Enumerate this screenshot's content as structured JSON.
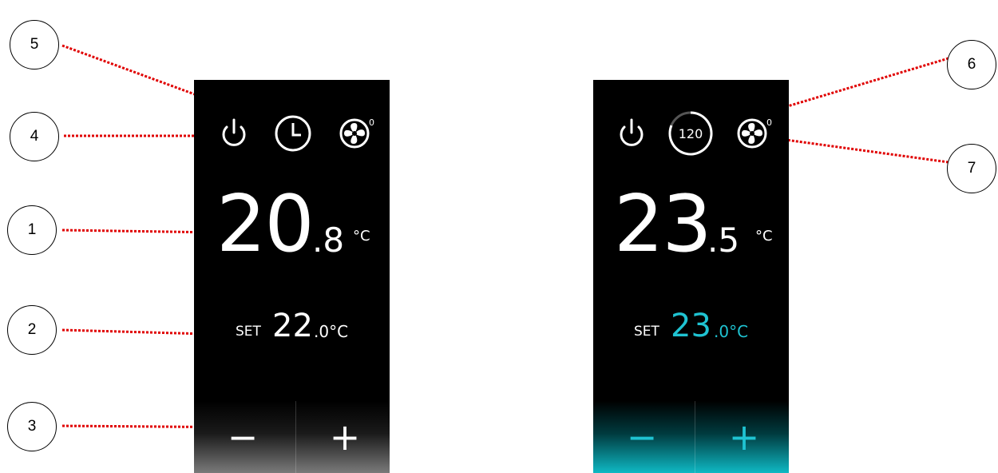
{
  "callouts": [
    {
      "num": "1"
    },
    {
      "num": "2"
    },
    {
      "num": "3"
    },
    {
      "num": "4"
    },
    {
      "num": "5"
    },
    {
      "num": "6"
    },
    {
      "num": "7"
    }
  ],
  "panel_a": {
    "temp_int": "20",
    "temp_dec": ".8",
    "temp_unit": "°C",
    "set_label": "SET",
    "set_int": "22",
    "set_dec": ".0°C",
    "minus": "−",
    "plus": "+",
    "fan_level": "0"
  },
  "panel_b": {
    "timer_value": "120",
    "temp_int": "23",
    "temp_dec": ".5",
    "temp_unit": "°C",
    "set_label": "SET",
    "set_int": "23",
    "set_dec": ".0°C",
    "minus": "−",
    "plus": "+",
    "fan_level": "0"
  },
  "colors": {
    "accent": "#1fc3d2",
    "panel_bg": "#000000",
    "leader": "#e00000"
  }
}
